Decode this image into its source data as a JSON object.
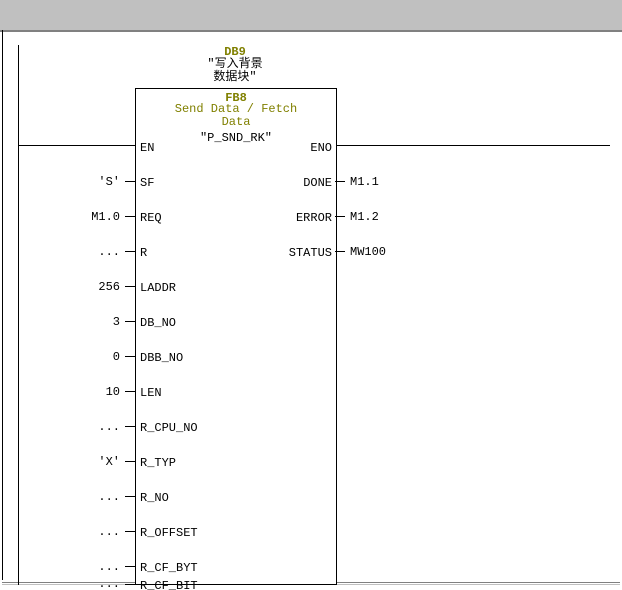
{
  "header": {
    "db_label": "DB9",
    "db_comment_line1": "\"写入背景",
    "db_comment_line2": "数据块\""
  },
  "block": {
    "fb_label": "FB8",
    "fb_desc_line1": "Send Data / Fetch",
    "fb_desc_line2": "Data",
    "fb_symbol": "\"P_SND_RK\""
  },
  "pins": {
    "en": "EN",
    "eno": "ENO",
    "sf": {
      "name": "SF",
      "value": "'S'"
    },
    "req": {
      "name": "REQ",
      "value": "M1.0"
    },
    "r": {
      "name": "R",
      "value": "..."
    },
    "laddr": {
      "name": "LADDR",
      "value": "256"
    },
    "db_no": {
      "name": "DB_NO",
      "value": "3"
    },
    "dbb_no": {
      "name": "DBB_NO",
      "value": "0"
    },
    "len": {
      "name": "LEN",
      "value": "10"
    },
    "r_cpu_no": {
      "name": "R_CPU_NO",
      "value": "..."
    },
    "r_typ": {
      "name": "R_TYP",
      "value": "'X'"
    },
    "r_no": {
      "name": "R_NO",
      "value": "..."
    },
    "r_offset": {
      "name": "R_OFFSET",
      "value": "..."
    },
    "r_cf_byt": {
      "name": "R_CF_BYT",
      "value": "..."
    },
    "r_cf_bit": {
      "name": "R_CF_BIT",
      "value": "..."
    },
    "done": {
      "name": "DONE",
      "value": "M1.1"
    },
    "error": {
      "name": "ERROR",
      "value": "M1.2"
    },
    "status": {
      "name": "STATUS",
      "value": "MW100"
    }
  }
}
